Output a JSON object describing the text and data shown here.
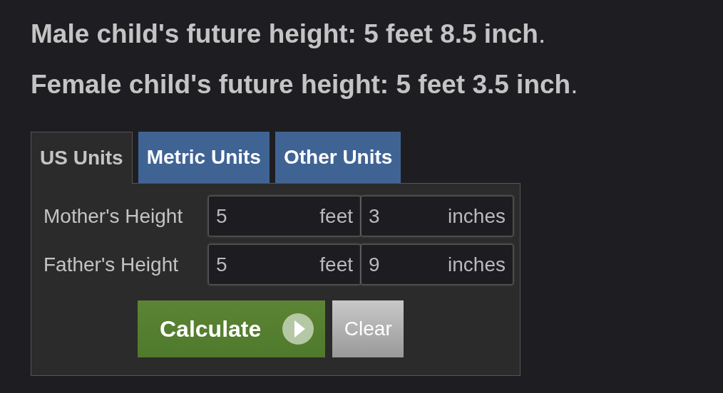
{
  "results": [
    "**Male child's future height: 5 feet 8.5 inch**.",
    "**Female child's future height: 5 feet 3.5 inch**."
  ],
  "tabs": [
    {
      "label": "US Units",
      "selected": true
    },
    {
      "label": "Metric Units",
      "selected": false
    },
    {
      "label": "Other Units",
      "selected": false
    }
  ],
  "rows": [
    {
      "label": "Mother's Height",
      "fields": [
        {
          "value": "5",
          "unit": "feet"
        },
        {
          "value": "3",
          "unit": "inches"
        }
      ]
    },
    {
      "label": "Father's Height",
      "fields": [
        {
          "value": "5",
          "unit": "feet"
        },
        {
          "value": "9",
          "unit": "inches"
        }
      ]
    }
  ],
  "buttons": [
    {
      "kind": "primary",
      "label": "Calculate"
    },
    {
      "kind": "secondary",
      "label": "Clear"
    }
  ]
}
